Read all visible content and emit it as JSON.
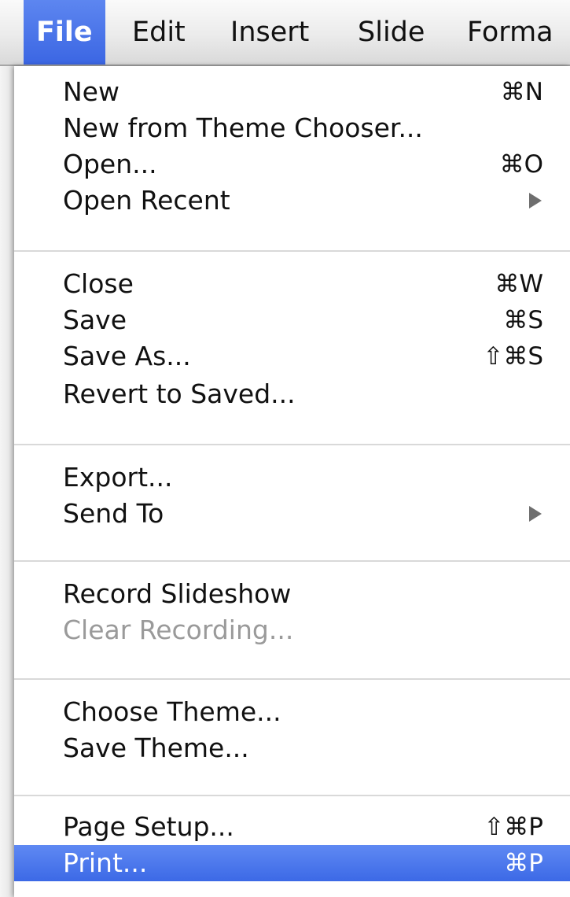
{
  "menubar": {
    "items": [
      {
        "label": "File",
        "active": true
      },
      {
        "label": "Edit"
      },
      {
        "label": "Insert"
      },
      {
        "label": "Slide"
      },
      {
        "label": "Forma"
      }
    ]
  },
  "menu": {
    "groups": [
      {
        "items": [
          {
            "label": "New",
            "shortcut": "⌘N"
          },
          {
            "label": "New from Theme Chooser...",
            "shortcut": ""
          },
          {
            "label": "Open...",
            "shortcut": "⌘O"
          },
          {
            "label": "Open Recent",
            "submenu": true
          }
        ]
      },
      {
        "items": [
          {
            "label": "Close",
            "shortcut": "⌘W"
          },
          {
            "label": "Save",
            "shortcut": "⌘S"
          },
          {
            "label": "Save As...",
            "shortcut": "⇧⌘S"
          },
          {
            "label": "Revert to Saved...",
            "shortcut": ""
          }
        ]
      },
      {
        "items": [
          {
            "label": "Export...",
            "shortcut": ""
          },
          {
            "label": "Send To",
            "submenu": true
          }
        ]
      },
      {
        "items": [
          {
            "label": "Record Slideshow",
            "shortcut": ""
          },
          {
            "label": "Clear Recording...",
            "shortcut": "",
            "disabled": true
          }
        ]
      },
      {
        "items": [
          {
            "label": "Choose Theme...",
            "shortcut": ""
          },
          {
            "label": "Save Theme...",
            "shortcut": ""
          }
        ]
      },
      {
        "items": [
          {
            "label": "Page Setup...",
            "shortcut": "⇧⌘P"
          },
          {
            "label": "Print...",
            "shortcut": "⌘P",
            "highlighted": true
          }
        ]
      }
    ]
  },
  "colors": {
    "selection": "#3c69e6",
    "disabled_text": "#9a9a9a",
    "separator": "#d9d9d9",
    "submenu_arrow": "#6e6e6e"
  },
  "icons": {
    "submenu": "triangle-right-icon"
  }
}
